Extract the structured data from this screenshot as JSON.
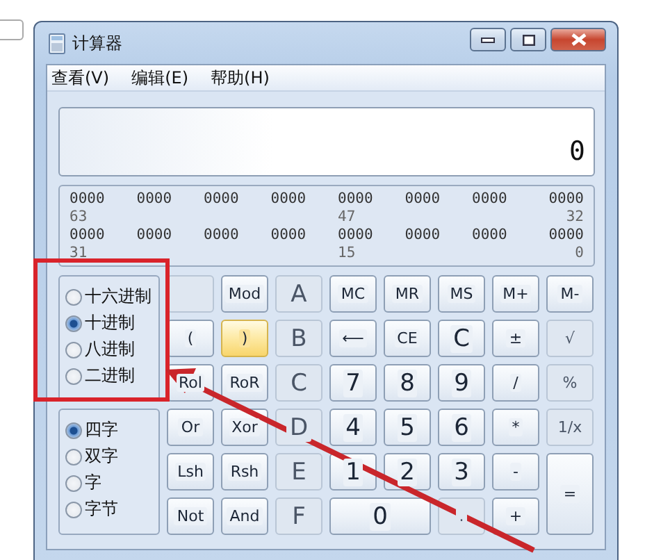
{
  "page_checkbox": {
    "checked": false
  },
  "window": {
    "title": "计算器"
  },
  "menu": [
    "查看(V)",
    "编辑(E)",
    "帮助(H)"
  ],
  "display": {
    "value": "0"
  },
  "bit_display": {
    "rows": [
      {
        "bits": [
          "0000",
          "0000",
          "0000",
          "0000",
          "0000",
          "0000",
          "0000",
          "0000"
        ],
        "labels": [
          "63",
          "47",
          "32"
        ]
      },
      {
        "bits": [
          "0000",
          "0000",
          "0000",
          "0000",
          "0000",
          "0000",
          "0000",
          "0000"
        ],
        "labels": [
          "31",
          "15",
          "0"
        ]
      }
    ]
  },
  "base_modes": [
    {
      "label": "十六进制",
      "selected": false
    },
    {
      "label": "十进制",
      "selected": true
    },
    {
      "label": "八进制",
      "selected": false
    },
    {
      "label": "二进制",
      "selected": false
    }
  ],
  "word_sizes": [
    {
      "label": "四字",
      "selected": true
    },
    {
      "label": "双字",
      "selected": false
    },
    {
      "label": "字",
      "selected": false
    },
    {
      "label": "字节",
      "selected": false
    }
  ],
  "keys": [
    {
      "kind": "blank",
      "disabled": true,
      "hovered": false
    },
    {
      "label": "Mod",
      "disabled": false,
      "hovered": false
    },
    {
      "label": "A",
      "disabled": true,
      "hovered": false
    },
    {
      "label": "MC",
      "disabled": false,
      "hovered": false
    },
    {
      "label": "MR",
      "disabled": false,
      "hovered": false
    },
    {
      "label": "MS",
      "disabled": false,
      "hovered": false
    },
    {
      "label": "M+",
      "disabled": false,
      "hovered": false
    },
    {
      "label": "M-",
      "disabled": false,
      "hovered": false
    },
    {
      "label": "(",
      "disabled": false,
      "hovered": false
    },
    {
      "label": ")",
      "disabled": false,
      "hovered": true
    },
    {
      "label": "B",
      "disabled": true,
      "hovered": false
    },
    {
      "label": "⟵",
      "disabled": false,
      "hovered": false
    },
    {
      "label": "CE",
      "disabled": false,
      "hovered": false
    },
    {
      "label": "C",
      "disabled": false,
      "hovered": false
    },
    {
      "label": "±",
      "disabled": false,
      "hovered": false
    },
    {
      "label": "√",
      "disabled": true,
      "hovered": false
    },
    {
      "label": "Rol",
      "disabled": false,
      "hovered": false
    },
    {
      "label": "RoR",
      "disabled": false,
      "hovered": false
    },
    {
      "label": "C",
      "disabled": true,
      "hovered": false
    },
    {
      "label": "7",
      "disabled": false,
      "hovered": false
    },
    {
      "label": "8",
      "disabled": false,
      "hovered": false
    },
    {
      "label": "9",
      "disabled": false,
      "hovered": false
    },
    {
      "label": "/",
      "disabled": false,
      "hovered": false
    },
    {
      "label": "%",
      "disabled": true,
      "hovered": false
    },
    {
      "label": "Or",
      "disabled": false,
      "hovered": false
    },
    {
      "label": "Xor",
      "disabled": false,
      "hovered": false
    },
    {
      "label": "D",
      "disabled": true,
      "hovered": false
    },
    {
      "label": "4",
      "disabled": false,
      "hovered": false
    },
    {
      "label": "5",
      "disabled": false,
      "hovered": false
    },
    {
      "label": "6",
      "disabled": false,
      "hovered": false
    },
    {
      "label": "*",
      "disabled": false,
      "hovered": false
    },
    {
      "label": "1/x",
      "disabled": true,
      "hovered": false
    },
    {
      "label": "Lsh",
      "disabled": false,
      "hovered": false
    },
    {
      "label": "Rsh",
      "disabled": false,
      "hovered": false
    },
    {
      "label": "E",
      "disabled": true,
      "hovered": false
    },
    {
      "label": "1",
      "disabled": false,
      "hovered": false
    },
    {
      "label": "2",
      "disabled": false,
      "hovered": false
    },
    {
      "label": "3",
      "disabled": false,
      "hovered": false
    },
    {
      "label": "-",
      "disabled": false,
      "hovered": false
    },
    {
      "label": "=",
      "kind": "tall",
      "disabled": false,
      "hovered": false
    },
    {
      "label": "Not",
      "disabled": false,
      "hovered": false
    },
    {
      "label": "And",
      "disabled": false,
      "hovered": false
    },
    {
      "label": "F",
      "disabled": true,
      "hovered": false
    },
    {
      "label": "0",
      "kind": "wide",
      "disabled": false,
      "hovered": false
    },
    {
      "label": ".",
      "disabled": true,
      "hovered": false
    },
    {
      "label": "+",
      "disabled": false,
      "hovered": false
    }
  ]
}
